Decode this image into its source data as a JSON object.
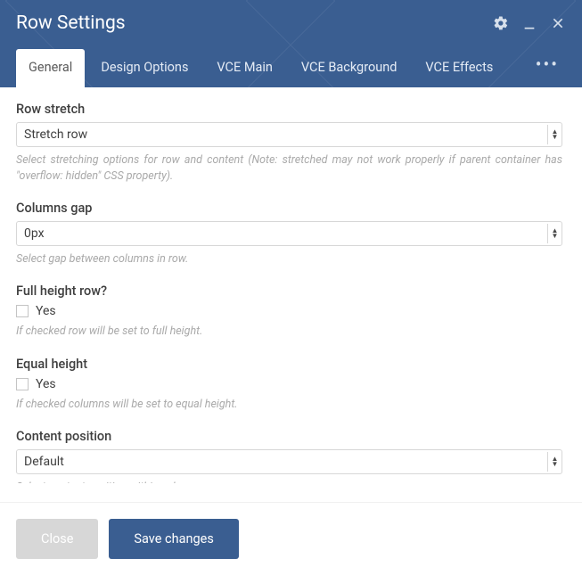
{
  "title": "Row Settings",
  "tabs": {
    "t0": "General",
    "t1": "Design Options",
    "t2": "VCE Main",
    "t3": "VCE Background",
    "t4": "VCE Effects"
  },
  "fields": {
    "row_stretch": {
      "label": "Row stretch",
      "value": "Stretch row",
      "help": "Select stretching options for row and content (Note: stretched may not work properly if parent container has \"overflow: hidden\" CSS property)."
    },
    "columns_gap": {
      "label": "Columns gap",
      "value": "0px",
      "help": "Select gap between columns in row."
    },
    "full_height": {
      "label": "Full height row?",
      "option": "Yes",
      "help": "If checked row will be set to full height."
    },
    "equal_height": {
      "label": "Equal height",
      "option": "Yes",
      "help": "If checked columns will be set to equal height."
    },
    "content_position": {
      "label": "Content position",
      "value": "Default",
      "help": "Select content position within columns."
    }
  },
  "footer": {
    "close": "Close",
    "save": "Save changes"
  }
}
